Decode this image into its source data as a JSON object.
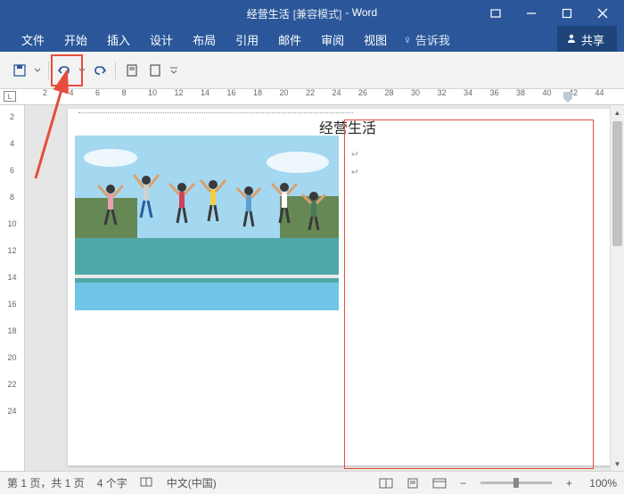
{
  "title_bar": {
    "document_name": "经营生活",
    "mode": "[兼容模式]",
    "app_name": "- Word"
  },
  "menu": {
    "file": "文件",
    "home": "开始",
    "insert": "插入",
    "design": "设计",
    "layout": "布局",
    "references": "引用",
    "mailings": "邮件",
    "review": "审阅",
    "view": "视图",
    "tell_me": "告诉我",
    "share": "共享"
  },
  "ruler_h": [
    2,
    4,
    6,
    8,
    10,
    12,
    14,
    16,
    18,
    20,
    22,
    24,
    26,
    28,
    30,
    32,
    34,
    36,
    38,
    40,
    42,
    44
  ],
  "ruler_v": [
    2,
    4,
    6,
    8,
    10,
    12,
    14,
    16,
    18,
    20,
    22,
    24
  ],
  "document": {
    "heading": "经营生活"
  },
  "status": {
    "page": "第 1 页，共 1 页",
    "words": "4 个字",
    "language": "中文(中国)",
    "zoom": "100%"
  },
  "icons": {
    "ribbon_display": "▭",
    "minimize": "—",
    "maximize": "☐",
    "close": "✕",
    "bulb": "💡",
    "person": "👤"
  }
}
